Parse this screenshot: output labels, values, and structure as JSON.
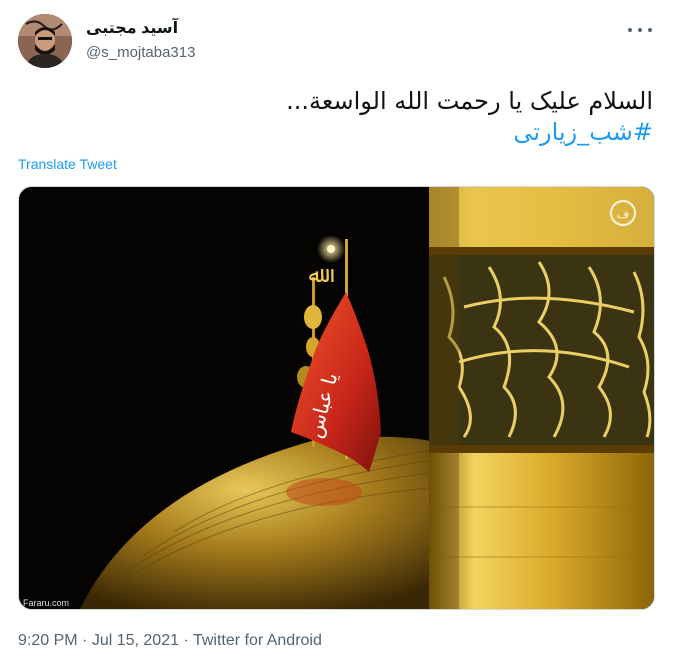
{
  "tweet": {
    "display_name": "آسید مجتبی",
    "handle": "@s_mojtaba313",
    "text": "السلام علیک یا رحمت الله الواسعة...",
    "hashtag": "#شب_زیارتی",
    "translate_label": "Translate Tweet",
    "time": "9:20 PM",
    "separator": " · ",
    "date": "Jul 15, 2021",
    "source": "Twitter for Android"
  },
  "media": {
    "watermark": "Fararu.com",
    "flag_text": "یا عباس",
    "icon": "shrine-dome-photo"
  },
  "colors": {
    "accent": "#1d9bf0",
    "text_primary": "#0f1419",
    "text_secondary": "#536471",
    "flag_red": "#d8341c",
    "gold": "#c9a227"
  }
}
